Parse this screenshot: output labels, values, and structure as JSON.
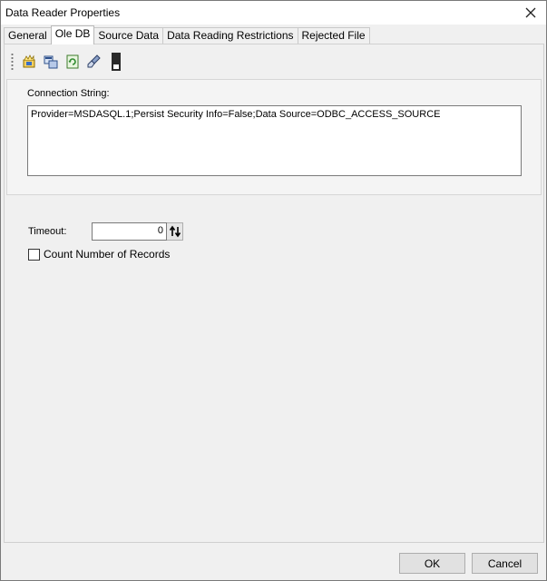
{
  "window": {
    "title": "Data Reader Properties"
  },
  "tabs": [
    {
      "label": "General",
      "active": false
    },
    {
      "label": "Ole DB",
      "active": true
    },
    {
      "label": "Source Data",
      "active": false
    },
    {
      "label": "Data Reading Restrictions",
      "active": false
    },
    {
      "label": "Rejected File",
      "active": false
    }
  ],
  "toolbar": {
    "icons": [
      "build-connection-icon",
      "data-link-icon",
      "refresh-icon",
      "clear-icon",
      "file-icon"
    ]
  },
  "connection": {
    "label": "Connection String:",
    "value": "Provider=MSDASQL.1;Persist Security Info=False;Data Source=ODBC_ACCESS_SOURCE"
  },
  "timeout": {
    "label": "Timeout:",
    "value": "0"
  },
  "count_records": {
    "label": "Count Number of Records",
    "checked": false
  },
  "buttons": {
    "ok": "OK",
    "cancel": "Cancel"
  }
}
